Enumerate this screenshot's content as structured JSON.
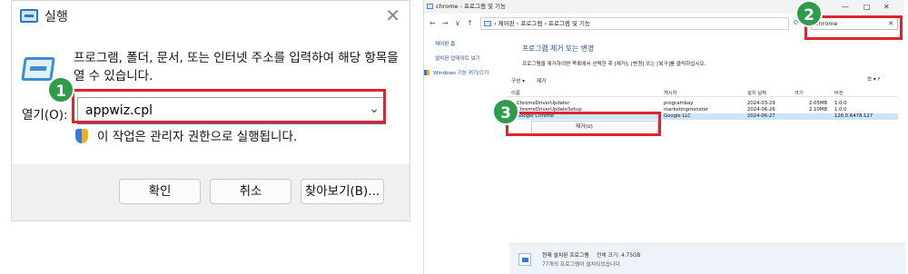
{
  "run_dialog": {
    "title": "실행",
    "close_glyph": "✕",
    "description": "프로그램, 폴더, 문서, 또는 인터넷 주소를 입력하여 해당 항목을 열 수 있습니다.",
    "open_label": "열기(O):",
    "open_value": "appwiz.cpl",
    "admin_note": "이 작업은 관리자 권한으로 실행됩니다.",
    "buttons": {
      "ok": "확인",
      "cancel": "취소",
      "browse": "찾아보기(B)..."
    }
  },
  "badges": [
    "1",
    "2",
    "3"
  ],
  "programs_window": {
    "title": "chrome - 프로그램 및 기능",
    "window_controls": [
      "—",
      "□",
      "✕"
    ],
    "nav_glyphs": [
      "←",
      "→",
      "∨",
      "↑"
    ],
    "address": "›  제어판  ›  프로그램  ›  프로그램 및 기능",
    "search_value": "chrome",
    "sidebar": [
      "제어판 홈",
      "설치된 업데이트 보기",
      "Windows 기능 켜기/끄기"
    ],
    "heading": "프로그램 제거 또는 변경",
    "subheading": "프로그램을 제거하려면 목록에서 선택한 후 [제거], [변경] 또는 [복구]를 클릭하십시오.",
    "toolbar": {
      "organize": "구성 ▾",
      "uninstall": "제거",
      "view": "☰ ▾  ?"
    },
    "columns": [
      "이름",
      "게시자",
      "설치 날짜",
      "크기",
      "버전"
    ],
    "rows": [
      {
        "name": "ChromeDriverUpdater",
        "publisher": "programbay",
        "date": "2024-03-29",
        "size": "2.05MB",
        "version": "1.0.0"
      },
      {
        "name": "ChromeDriverUpdateSetup",
        "publisher": "marketingmonster",
        "date": "2024-06-26",
        "size": "2.10MB",
        "version": "1.0.0"
      },
      {
        "name": "Google Chrome",
        "publisher": "Google LLC",
        "date": "2024-06-27",
        "size": "",
        "version": "126.0.6478.127"
      }
    ],
    "context_menu_item": "제거(U)",
    "status": {
      "label": "현재 설치된 프로그램",
      "total_size": "전체 크기:  4.75GB",
      "count": "77개의 프로그램이 설치되었습니다."
    }
  },
  "colors": {
    "highlight": "#e0242c",
    "badge": "#2e9c4a",
    "selection": "#cce4f7"
  }
}
